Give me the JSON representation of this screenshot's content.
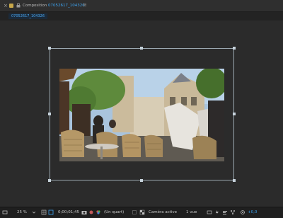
{
  "titlebar": {
    "close_glyph": "×",
    "label": "Composition",
    "comp_name": "07052617_104326",
    "menu_glyph": "≡"
  },
  "tabs": [
    {
      "label": "07052617_104326",
      "active": true
    }
  ],
  "bottombar": {
    "magnification": "25 %",
    "timecode": "0;00;01;45",
    "resolution": "(Un quart)",
    "camera": "Caméra active",
    "views": "1 vue",
    "exposure": "+0,0"
  },
  "colors": {
    "accent": "#3ea6f5",
    "label_swatch": "#c8a84a",
    "panel_bg": "#2b2b2b",
    "bounding_box": "#9aa7b0"
  },
  "icons": {
    "close": "close-icon",
    "lock": "lock-icon",
    "menu": "panel-menu-icon"
  }
}
